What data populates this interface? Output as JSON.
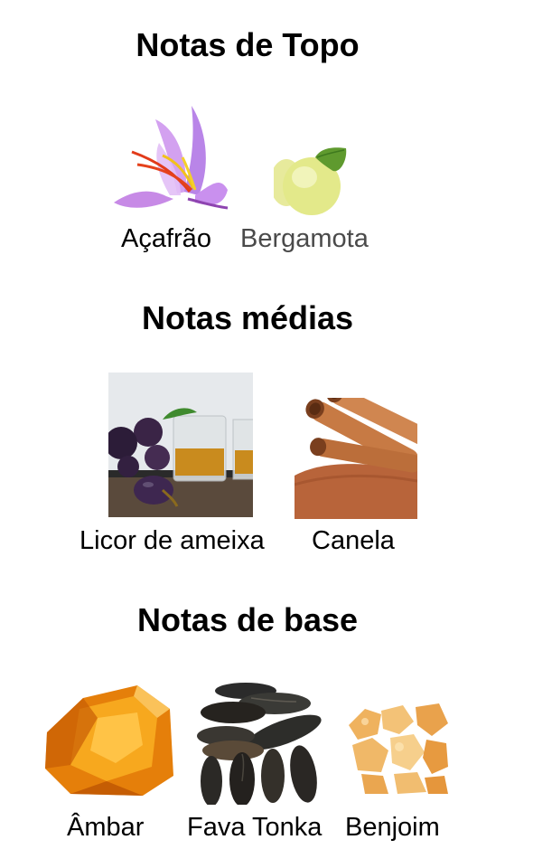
{
  "sections": {
    "top": {
      "title": "Notas de Topo",
      "notes": [
        {
          "label": "Açafrão",
          "icon": "saffron-flower-image"
        },
        {
          "label": "Bergamota",
          "icon": "bergamot-fruit-image"
        }
      ]
    },
    "middle": {
      "title": "Notas médias",
      "notes": [
        {
          "label": "Licor de ameixa",
          "icon": "plum-liqueur-image"
        },
        {
          "label": "Canela",
          "icon": "cinnamon-sticks-image"
        }
      ]
    },
    "base": {
      "title": "Notas de base",
      "notes": [
        {
          "label": "Âmbar",
          "icon": "amber-resin-image"
        },
        {
          "label": "Fava Tonka",
          "icon": "tonka-beans-image"
        },
        {
          "label": "Benjoim",
          "icon": "benzoin-resin-image"
        }
      ]
    }
  },
  "colors": {
    "text": "#000000",
    "link_text": "#4a4a4a",
    "background": "#ffffff"
  }
}
